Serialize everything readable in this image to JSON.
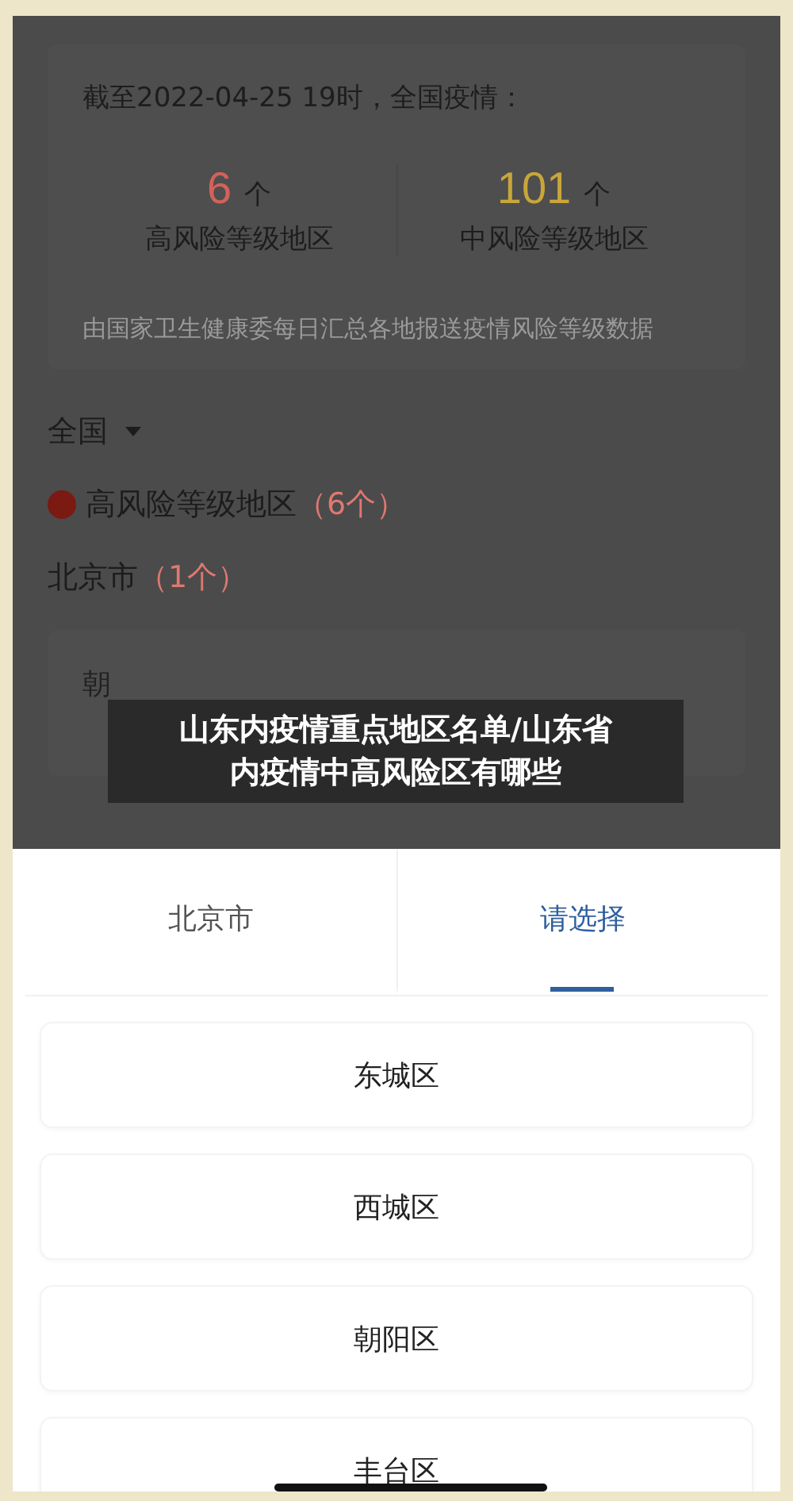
{
  "summary": {
    "title": "截至2022-04-25 19时，全国疫情：",
    "stats": [
      {
        "count": "6",
        "unit": "个",
        "label": "高风险等级地区",
        "color": "#d2625a"
      },
      {
        "count": "101",
        "unit": "个",
        "label": "中风险等级地区",
        "color": "#c9a63a"
      }
    ],
    "note": "由国家卫生健康委每日汇总各地报送疫情风险等级数据"
  },
  "region_filter": {
    "label": "全国"
  },
  "risk_section": {
    "label": "高风险等级地区",
    "count": "（6个）",
    "color": "#7a1a12"
  },
  "city": {
    "name": "北京市",
    "count": "（1个）"
  },
  "districts": [
    "朝"
  ],
  "caption": "山东内疫情重点地区名单/山东省内疫情中高风险区有哪些",
  "picker": {
    "tabs": [
      {
        "label": "北京市",
        "selected": false
      },
      {
        "label": "请选择",
        "selected": true
      }
    ],
    "options": [
      "东城区",
      "西城区",
      "朝阳区",
      "丰台区"
    ]
  }
}
